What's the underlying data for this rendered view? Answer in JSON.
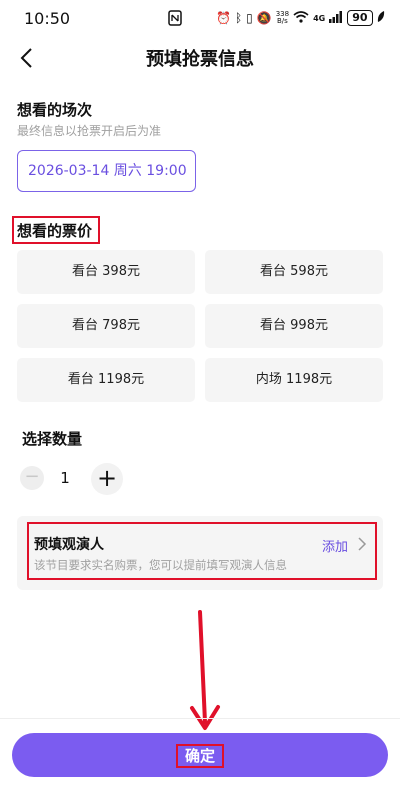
{
  "status_bar": {
    "time": "10:50",
    "network_speed_value": "338",
    "network_speed_unit": "B/s",
    "signal": "4G",
    "battery": "90"
  },
  "header": {
    "title": "预填抢票信息"
  },
  "session": {
    "title": "想看的场次",
    "subtitle": "最终信息以抢票开启后为准",
    "selected": "2026-03-14 周六 19:00"
  },
  "price": {
    "title": "想看的票价",
    "options": [
      "看台 398元",
      "看台 598元",
      "看台 798元",
      "看台 998元",
      "看台 1198元",
      "内场 1198元"
    ]
  },
  "quantity": {
    "title": "选择数量",
    "value": "1",
    "minus_symbol": "−",
    "plus_symbol": "+"
  },
  "attendee": {
    "title": "预填观演人",
    "add_label": "添加",
    "subtitle": "该节目要求实名购票，您可以提前填写观演人信息"
  },
  "confirm": {
    "label": "确定"
  },
  "colors": {
    "accent": "#7b5cf0",
    "annotation_red": "#e0102a"
  }
}
